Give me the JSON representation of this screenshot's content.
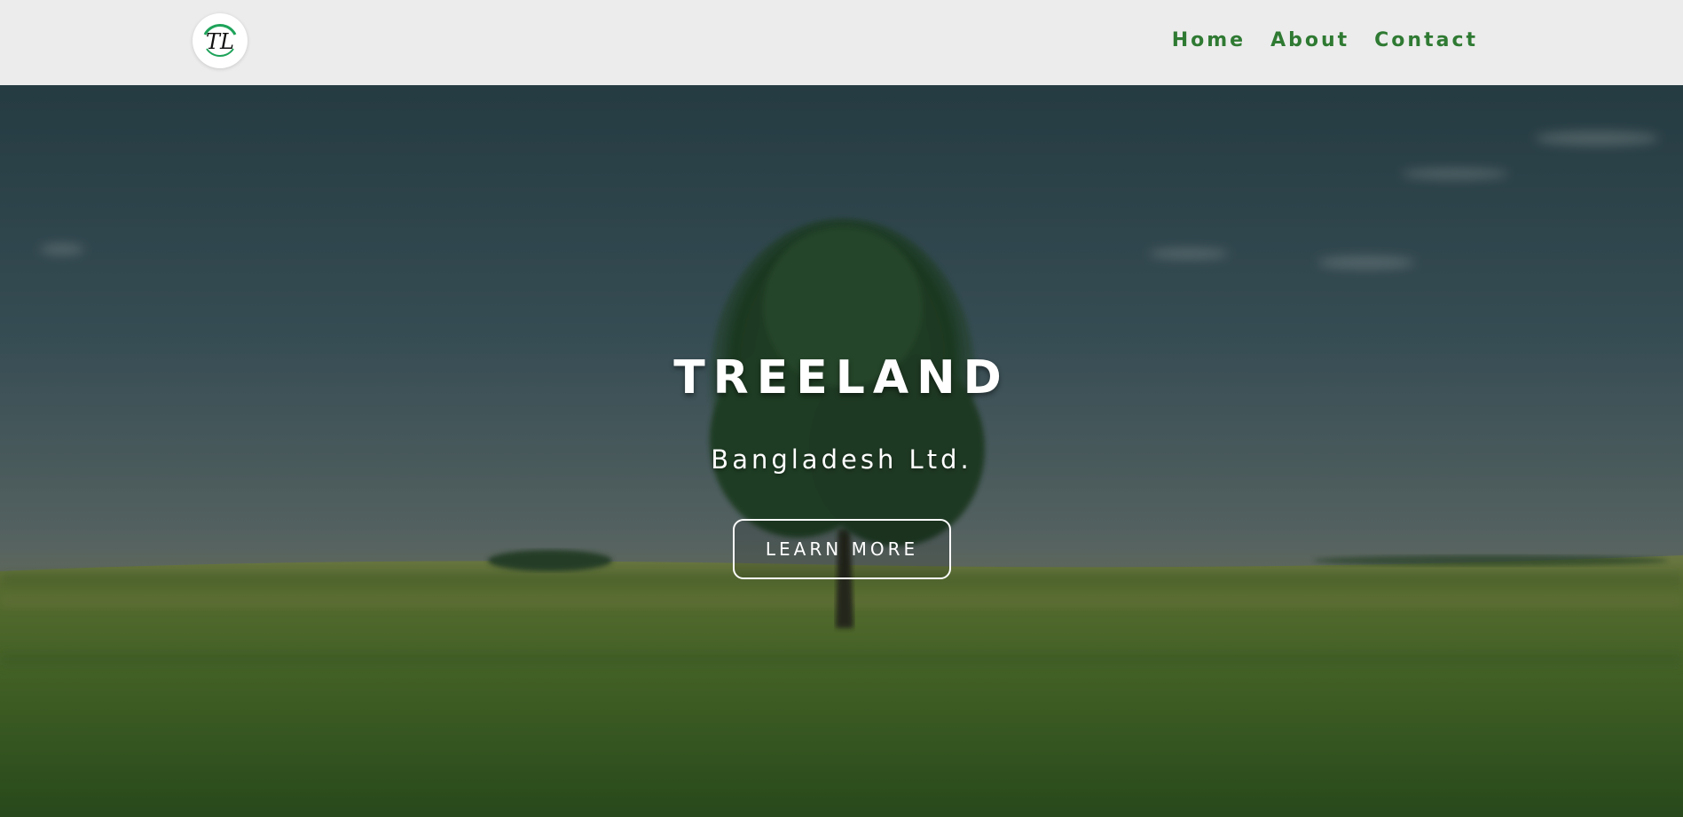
{
  "header": {
    "logo": {
      "text": "TL",
      "icon": "treeland-logo-icon",
      "ring_color": "#1ea35a"
    },
    "nav": [
      {
        "label": "Home"
      },
      {
        "label": "About"
      },
      {
        "label": "Contact"
      }
    ],
    "nav_color": "#2f7a33",
    "background": "#ececec"
  },
  "hero": {
    "title": "TREELAND",
    "subtitle": "Bangladesh Ltd.",
    "cta_label": "LEARN MORE",
    "background_scene": "tree-in-grass-field-image"
  }
}
